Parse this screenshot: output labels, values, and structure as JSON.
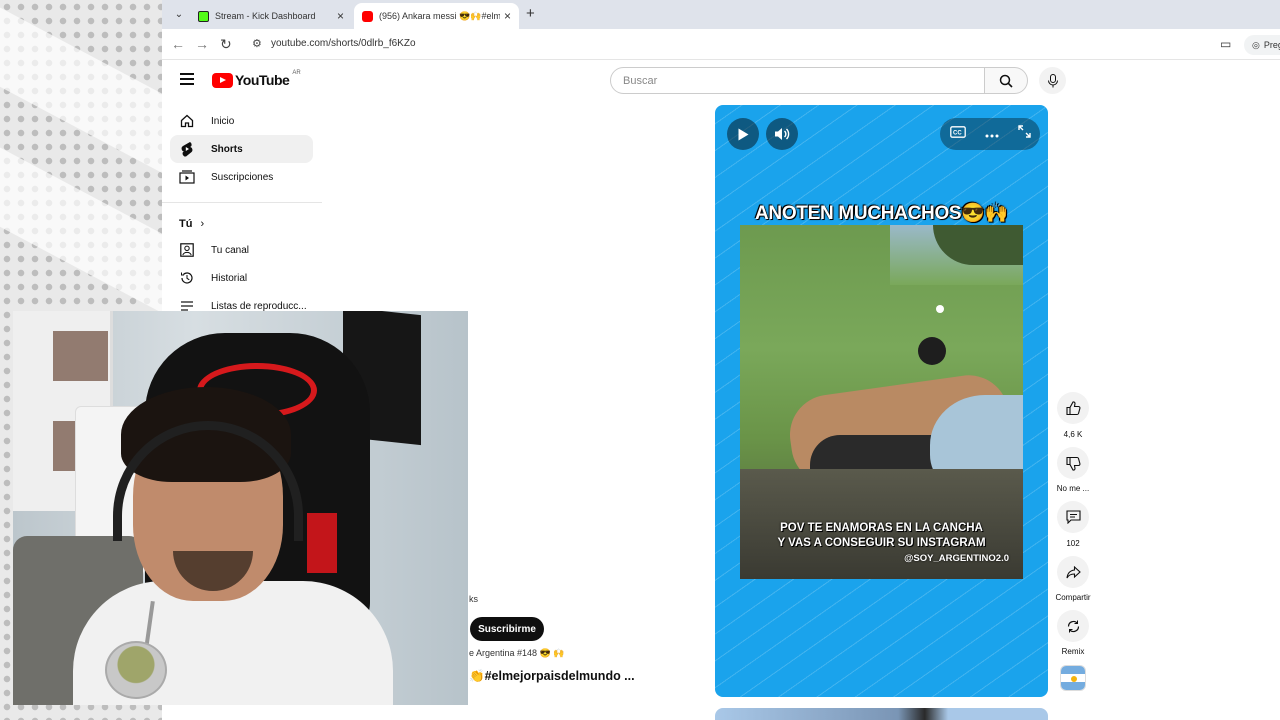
{
  "browser": {
    "tabs": [
      {
        "label": "Stream - Kick Dashboard",
        "icon": "kick-favicon"
      },
      {
        "label": "(956) Ankara messi 😎🙌#elm",
        "icon": "youtube-favicon"
      }
    ],
    "new_tab": "+",
    "url": "youtube.com/shorts/0dlrb_f6KZo",
    "ask_label": "Preg"
  },
  "youtube": {
    "logo_text": "YouTube",
    "region": "AR",
    "search_placeholder": "Buscar",
    "sidebar": {
      "items": [
        {
          "label": "Inicio",
          "icon": "home-icon"
        },
        {
          "label": "Shorts",
          "icon": "shorts-icon",
          "active": true
        },
        {
          "label": "Suscripciones",
          "icon": "subscriptions-icon"
        }
      ],
      "you_header": "Tú",
      "you_items": [
        {
          "label": "Tu canal",
          "icon": "account-icon"
        },
        {
          "label": "Historial",
          "icon": "history-icon"
        },
        {
          "label": "Listas de reproducc...",
          "icon": "playlists-icon"
        }
      ]
    },
    "short": {
      "top_caption": "ANOTEN MUCHACHOS😎🙌",
      "subtitle_line1": "POV TE ENAMORAS EN LA CANCHA",
      "subtitle_line2": "Y VAS A CONSEGUIR SU INSTAGRAM",
      "handle": "@SOY_ARGENTINO2.0"
    },
    "actions": {
      "like_count": "4,6 K",
      "dislike_label": "No me ...",
      "comment_count": "102",
      "share_label": "Compartir",
      "remix_label": "Remix"
    },
    "channel": {
      "shorts_fragment": "ks",
      "subscribe_label": "Suscribirme",
      "subtitle": "e Argentina #148 😎 🙌",
      "title": "👏#elmejorpaisdelmundo ..."
    }
  },
  "colors": {
    "short_bg": "#1aa3ec",
    "yt_red": "#ff0000",
    "subscribe_bg": "#0f0f0f"
  }
}
